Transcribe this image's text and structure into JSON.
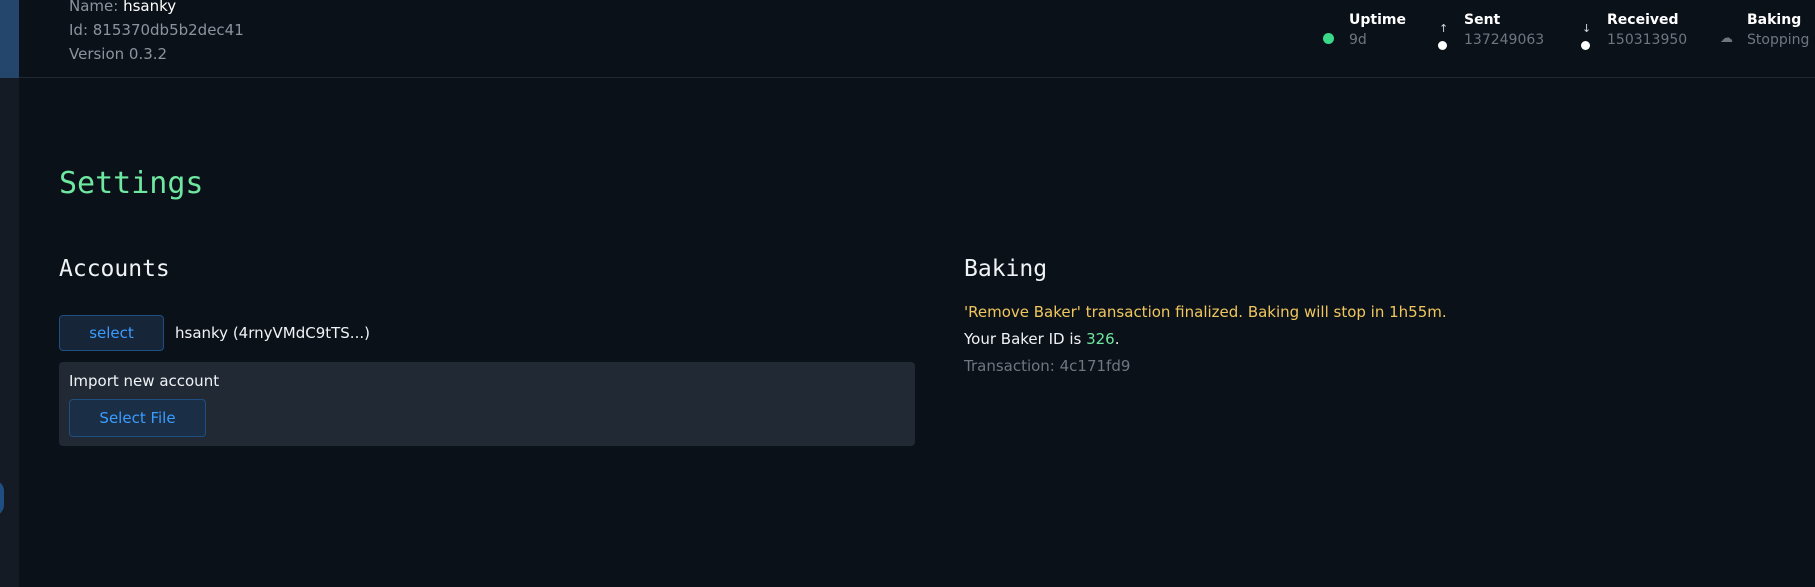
{
  "header": {
    "node_name_label": "Name: ",
    "node_name": "hsanky",
    "node_id": "Id: 815370db5b2dec41",
    "version": "Version 0.3.2",
    "stats": [
      {
        "icon": "status-dot-icon",
        "label": "Uptime",
        "value": "9d",
        "color": "#3bd88a"
      },
      {
        "icon": "arrow-up-icon",
        "label": "Sent",
        "value": "137249063"
      },
      {
        "icon": "arrow-down-icon",
        "label": "Received",
        "value": "150313950"
      },
      {
        "icon": "cake-icon",
        "label": "Baking",
        "value": "Stopping"
      }
    ]
  },
  "main": {
    "page_title": "Settings",
    "accounts": {
      "title": "Accounts",
      "select_button": "select",
      "current_account": "hsanky (4rnyVMdC9tTS...)",
      "import": {
        "label": "Import new account",
        "button": "Select File"
      }
    },
    "baking": {
      "title": "Baking",
      "status_message": "'Remove Baker' transaction finalized. Baking will stop in 1h55m.",
      "baker_id_prefix": "Your Baker ID is ",
      "baker_id": "326",
      "baker_id_suffix": ".",
      "transaction": "Transaction: 4c171fd9"
    }
  },
  "colors": {
    "accent_green": "#6ee7a0",
    "link_blue": "#3b9cff",
    "warning_yellow": "#f0c75e",
    "background": "#0b1118"
  }
}
